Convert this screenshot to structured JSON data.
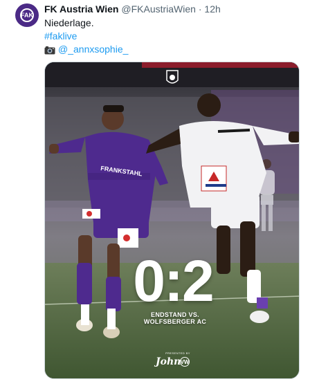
{
  "tweet": {
    "avatar_icon": "fk-austria-wien-crest-icon",
    "avatar_letters": "FAK",
    "name": "FK Austria Wien",
    "handle": "@FKAustriaWien",
    "separator": "·",
    "time": "12h",
    "text": "Niederlage.",
    "hashtag": "#faklive",
    "camera_icon": "camera-emoji-icon",
    "mention": "@_annxsophie_"
  },
  "media": {
    "score": "0:2",
    "result_label": "ENDSTAND VS. WOLFSBERGER AC",
    "presented_by": "PRESENTED BY",
    "sponsor": "John",
    "vw_badge": "VW",
    "jersey_sponsor": "FRANKSTAHL",
    "colors": {
      "austria_violet": "#4e2a8e",
      "wolfsberg_white": "#f2f2f4",
      "pitch_green": "#4c6b3a"
    }
  }
}
